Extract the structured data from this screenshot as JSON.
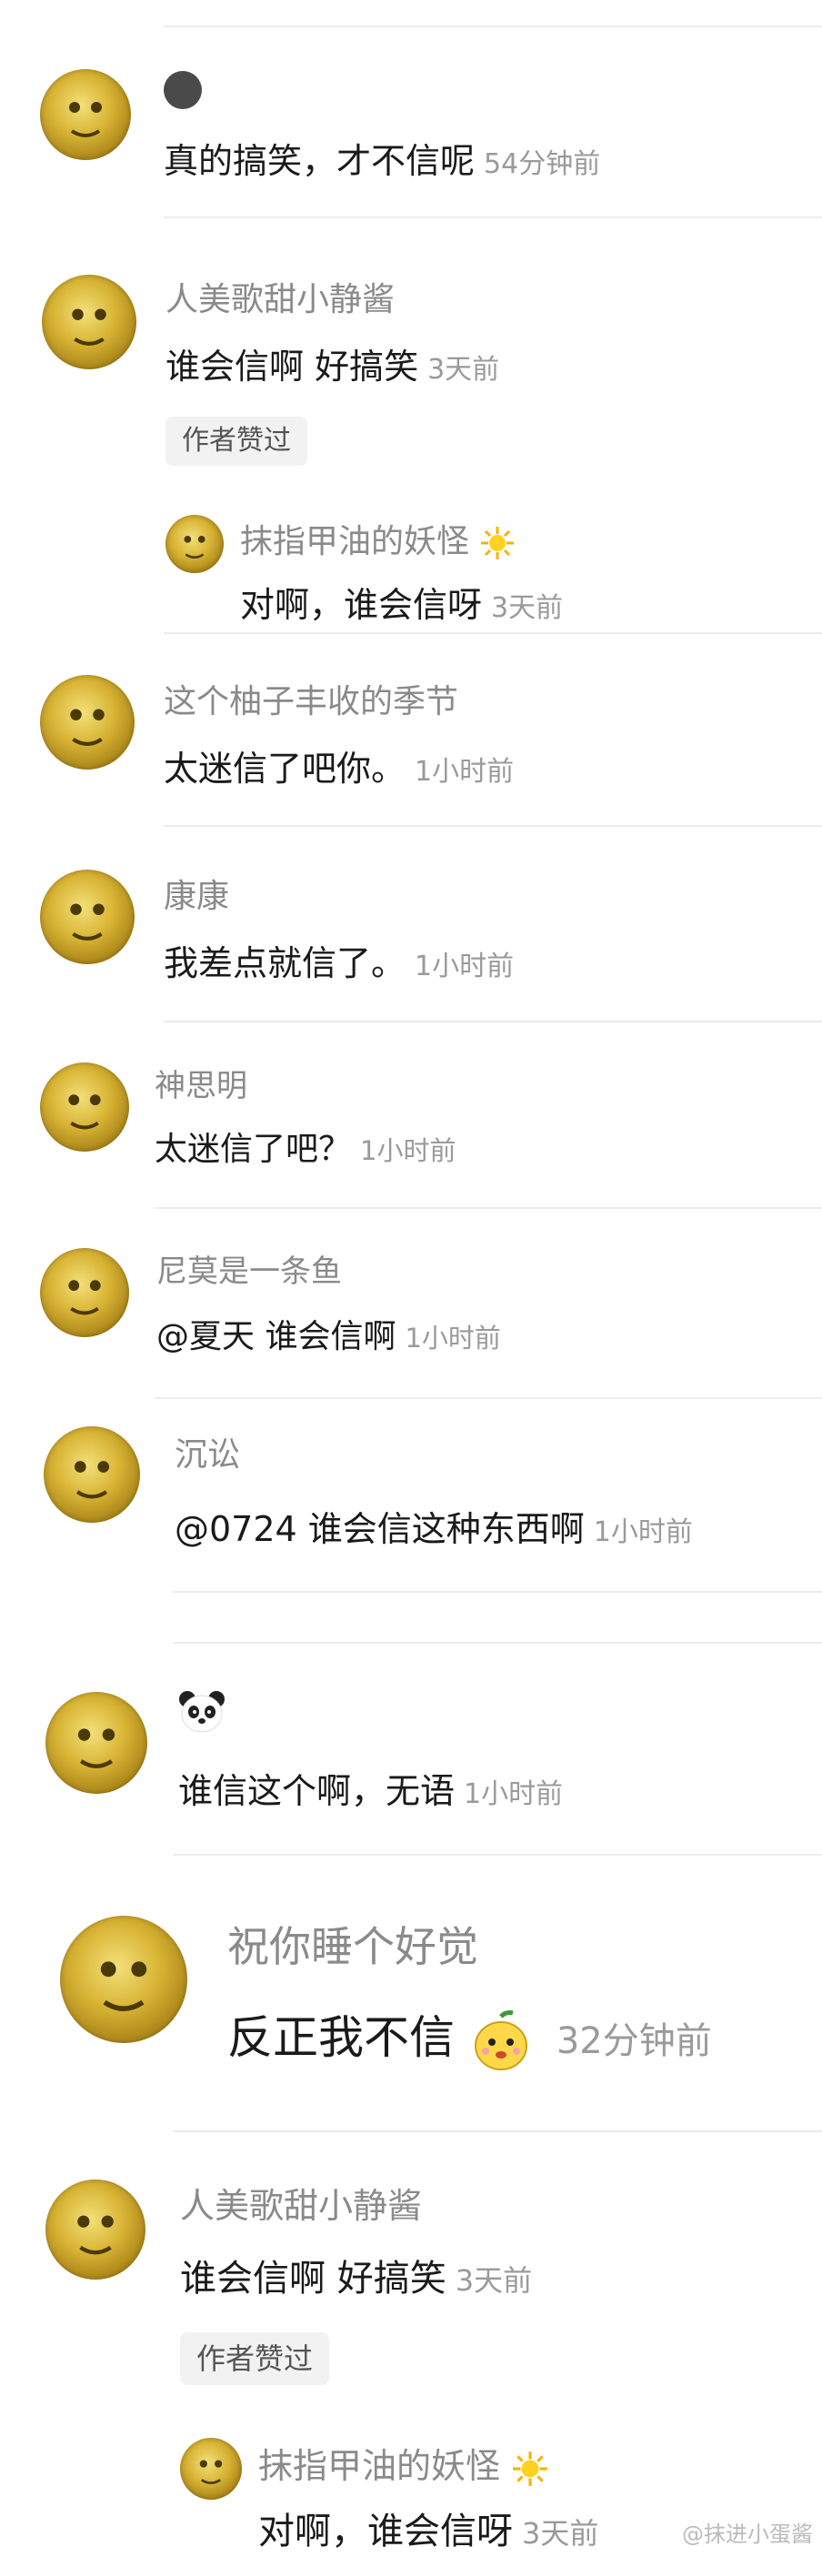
{
  "comments": [
    {
      "name": "",
      "text": "真的搞笑，才不信呢",
      "time": "54分钟前"
    },
    {
      "name": "人美歌甜小静酱",
      "text": "谁会信啊 好搞笑",
      "time": "3天前",
      "badge": "作者赞过",
      "reply": {
        "name": "抹指甲油的妖怪",
        "text": "对啊，谁会信呀",
        "time": "3天前"
      }
    },
    {
      "name": "这个柚子丰收的季节",
      "text": "太迷信了吧你。",
      "time": "1小时前"
    },
    {
      "name": "康康",
      "text": "我差点就信了。",
      "time": "1小时前"
    },
    {
      "name": "神思明",
      "text": "太迷信了吧？",
      "time": "1小时前"
    },
    {
      "name": "尼莫是一条鱼",
      "text": "@夏天 谁会信啊",
      "time": "1小时前"
    },
    {
      "name": "沉讼",
      "text": "@0724 谁会信这种东西啊",
      "time": "1小时前"
    },
    {
      "name": "",
      "text": "谁信这个啊，无语",
      "time": "1小时前"
    },
    {
      "name": "祝你睡个好觉",
      "text": "反正我不信",
      "time": "32分钟前"
    },
    {
      "name": "人美歌甜小静酱",
      "text": "谁会信啊 好搞笑",
      "time": "3天前",
      "badge": "作者赞过",
      "reply": {
        "name": "抹指甲油的妖怪",
        "text": "对啊，谁会信呀",
        "time": "3天前"
      }
    }
  ],
  "watermark": "@抹进小蛋酱"
}
